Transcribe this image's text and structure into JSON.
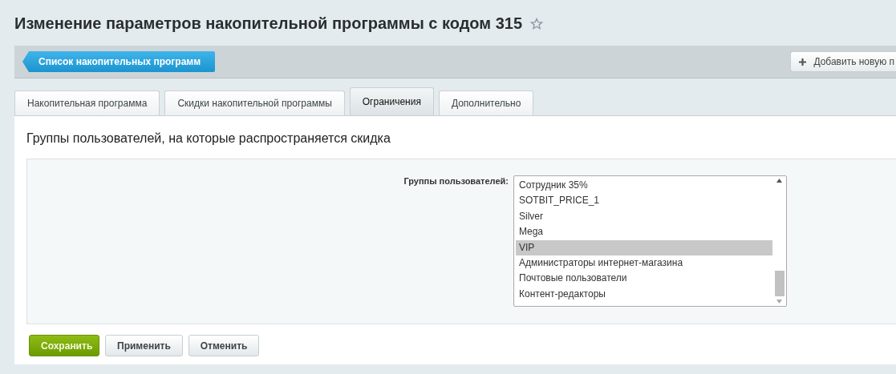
{
  "page_title": "Изменение параметров накопительной программы с кодом 315",
  "toolbar": {
    "back_button": "Список накопительных программ",
    "add_button": "Добавить новую п"
  },
  "tabs": [
    {
      "label": "Накопительная программа",
      "selected": false
    },
    {
      "label": "Скидки накопительной программы",
      "selected": false
    },
    {
      "label": "Ограничения",
      "selected": true
    },
    {
      "label": "Дополнительно",
      "selected": false
    }
  ],
  "section_title": "Группы пользователей, на которые распространяется скидка",
  "field": {
    "label": "Группы пользователей:",
    "options": [
      {
        "label": "Сотрудник 35%",
        "selected": false
      },
      {
        "label": "SOTBIT_PRICE_1",
        "selected": false
      },
      {
        "label": "Silver",
        "selected": false
      },
      {
        "label": "Mega",
        "selected": false
      },
      {
        "label": "VIP",
        "selected": true
      },
      {
        "label": "Администраторы интернет-магазина",
        "selected": false
      },
      {
        "label": "Почтовые пользователи",
        "selected": false
      },
      {
        "label": "Контент-редакторы",
        "selected": false
      }
    ]
  },
  "buttons": [
    {
      "label": "Сохранить",
      "kind": "primary"
    },
    {
      "label": "Применить",
      "kind": "default"
    },
    {
      "label": "Отменить",
      "kind": "default"
    }
  ]
}
